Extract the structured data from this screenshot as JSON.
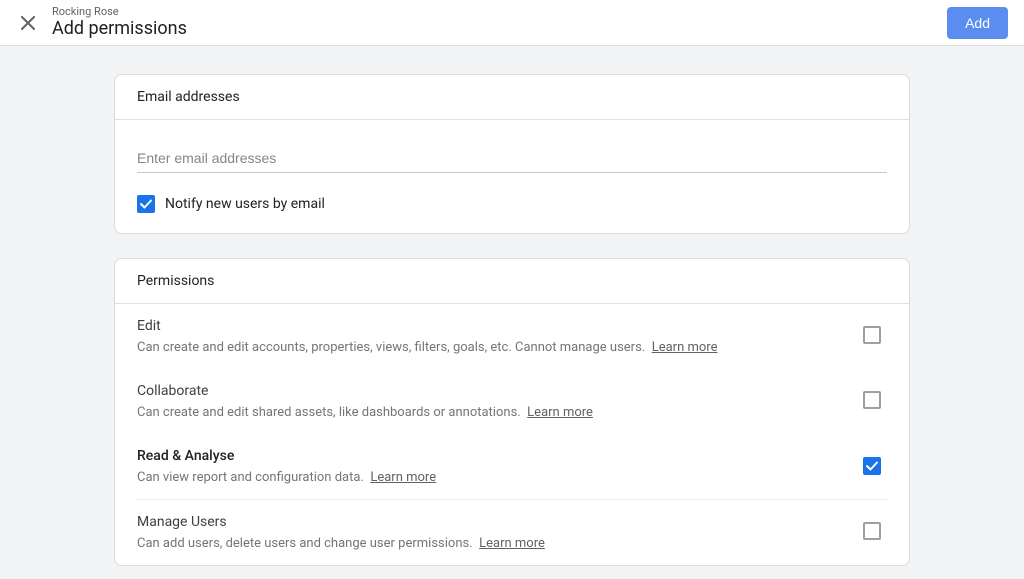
{
  "header": {
    "breadcrumb": "Rocking Rose",
    "title": "Add permissions",
    "action_label": "Add"
  },
  "email_section": {
    "heading": "Email addresses",
    "placeholder": "Enter email addresses",
    "value": "",
    "notify_label": "Notify new users by email",
    "notify_checked": true
  },
  "permissions_section": {
    "heading": "Permissions",
    "learn_more_label": "Learn more",
    "items": [
      {
        "title": "Edit",
        "desc": "Can create and edit accounts, properties, views, filters, goals, etc. Cannot manage users.",
        "checked": false
      },
      {
        "title": "Collaborate",
        "desc": "Can create and edit shared assets, like dashboards or annotations.",
        "checked": false
      },
      {
        "title": "Read & Analyse",
        "desc": "Can view report and configuration data.",
        "checked": true
      },
      {
        "title": "Manage Users",
        "desc": "Can add users, delete users and change user permissions.",
        "checked": false
      }
    ]
  }
}
